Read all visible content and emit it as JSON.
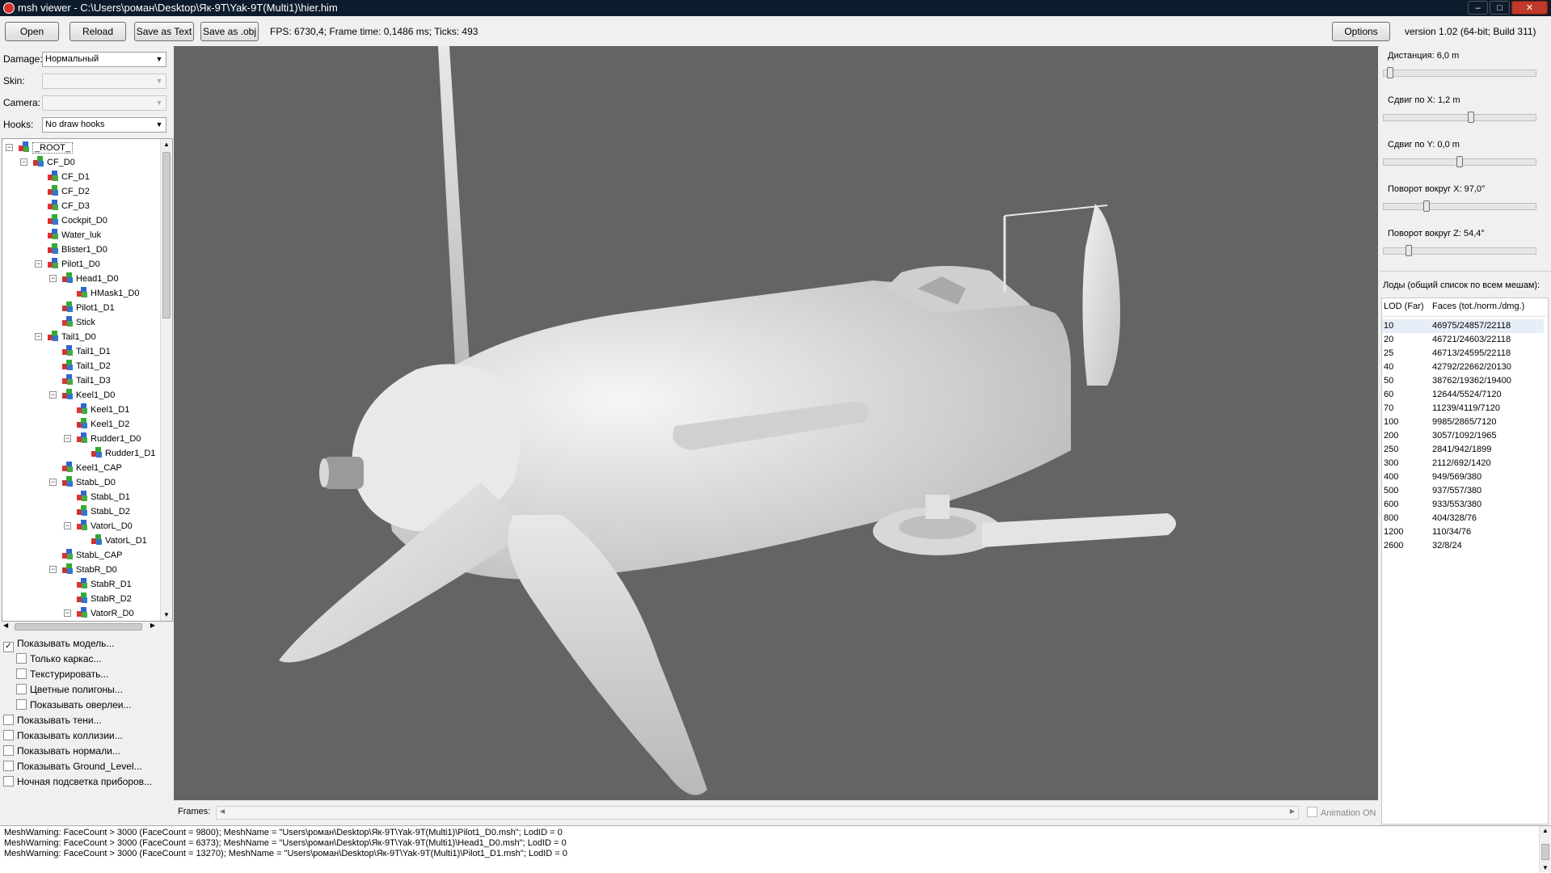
{
  "window": {
    "title": "msh viewer - C:\\Users\\роман\\Desktop\\Як-9Т\\Yak-9T(Multi1)\\hier.him"
  },
  "toolbar": {
    "open": "Open",
    "reload": "Reload",
    "save_text": "Save as Text",
    "save_obj": "Save as .obj",
    "stats": "FPS: 6730,4; Frame time: 0,1486 ms; Ticks: 493",
    "options": "Options",
    "version": "version 1.02 (64-bit; Build 311)"
  },
  "left": {
    "damage_label": "Damage:",
    "damage_value": "Нормальный",
    "skin_label": "Skin:",
    "skin_value": "",
    "camera_label": "Camera:",
    "camera_value": "",
    "hooks_label": "Hooks:",
    "hooks_value": "No draw hooks",
    "tree": [
      {
        "label": "_ROOT_",
        "depth": 0,
        "exp": "-"
      },
      {
        "label": "CF_D0",
        "depth": 1,
        "exp": "-"
      },
      {
        "label": "CF_D1",
        "depth": 2,
        "exp": ""
      },
      {
        "label": "CF_D2",
        "depth": 2,
        "exp": ""
      },
      {
        "label": "CF_D3",
        "depth": 2,
        "exp": ""
      },
      {
        "label": "Cockpit_D0",
        "depth": 2,
        "exp": ""
      },
      {
        "label": "Water_luk",
        "depth": 2,
        "exp": ""
      },
      {
        "label": "Blister1_D0",
        "depth": 2,
        "exp": ""
      },
      {
        "label": "Pilot1_D0",
        "depth": 2,
        "exp": "-"
      },
      {
        "label": "Head1_D0",
        "depth": 3,
        "exp": "-"
      },
      {
        "label": "HMask1_D0",
        "depth": 4,
        "exp": ""
      },
      {
        "label": "Pilot1_D1",
        "depth": 3,
        "exp": ""
      },
      {
        "label": "Stick",
        "depth": 3,
        "exp": ""
      },
      {
        "label": "Tail1_D0",
        "depth": 2,
        "exp": "-"
      },
      {
        "label": "Tail1_D1",
        "depth": 3,
        "exp": ""
      },
      {
        "label": "Tail1_D2",
        "depth": 3,
        "exp": ""
      },
      {
        "label": "Tail1_D3",
        "depth": 3,
        "exp": ""
      },
      {
        "label": "Keel1_D0",
        "depth": 3,
        "exp": "-"
      },
      {
        "label": "Keel1_D1",
        "depth": 4,
        "exp": ""
      },
      {
        "label": "Keel1_D2",
        "depth": 4,
        "exp": ""
      },
      {
        "label": "Rudder1_D0",
        "depth": 4,
        "exp": "-"
      },
      {
        "label": "Rudder1_D1",
        "depth": 5,
        "exp": ""
      },
      {
        "label": "Keel1_CAP",
        "depth": 3,
        "exp": ""
      },
      {
        "label": "StabL_D0",
        "depth": 3,
        "exp": "-"
      },
      {
        "label": "StabL_D1",
        "depth": 4,
        "exp": ""
      },
      {
        "label": "StabL_D2",
        "depth": 4,
        "exp": ""
      },
      {
        "label": "VatorL_D0",
        "depth": 4,
        "exp": "-"
      },
      {
        "label": "VatorL_D1",
        "depth": 5,
        "exp": ""
      },
      {
        "label": "StabL_CAP",
        "depth": 3,
        "exp": ""
      },
      {
        "label": "StabR_D0",
        "depth": 3,
        "exp": "-"
      },
      {
        "label": "StabR_D1",
        "depth": 4,
        "exp": ""
      },
      {
        "label": "StabR_D2",
        "depth": 4,
        "exp": ""
      },
      {
        "label": "VatorR_D0",
        "depth": 4,
        "exp": "-"
      }
    ],
    "checks": [
      {
        "label": "Показывать модель...",
        "checked": true,
        "indent": 0
      },
      {
        "label": "Только каркас...",
        "checked": false,
        "indent": 1
      },
      {
        "label": "Текстурировать...",
        "checked": false,
        "indent": 1
      },
      {
        "label": "Цветные полигоны...",
        "checked": false,
        "indent": 1
      },
      {
        "label": "Показывать оверлеи...",
        "checked": false,
        "indent": 1
      },
      {
        "label": "Показывать тени...",
        "checked": false,
        "indent": 0
      },
      {
        "label": "Показывать коллизии...",
        "checked": false,
        "indent": 0
      },
      {
        "label": "Показывать нормали...",
        "checked": false,
        "indent": 0
      },
      {
        "label": "Показывать Ground_Level...",
        "checked": false,
        "indent": 0
      },
      {
        "label": "Ночная подсветка приборов...",
        "checked": false,
        "indent": 0
      }
    ]
  },
  "frames": {
    "label": "Frames:",
    "animation": "Animation ON"
  },
  "right": {
    "sliders": [
      {
        "label": "Дистанция:  6,0 m",
        "value": 0.02
      },
      {
        "label": "Сдвиг по X:  1,2 m",
        "value": 0.58
      },
      {
        "label": "Сдвиг по Y:  0,0 m",
        "value": 0.5
      },
      {
        "label": "Поворот вокруг X:  97,0°",
        "value": 0.27
      },
      {
        "label": "Поворот вокруг Z:  54,4°",
        "value": 0.15
      }
    ],
    "lod_title": "Лоды (общий список по всем мешам):",
    "lod_header": [
      "LOD (Far)",
      "Faces (tot./norm./dmg.)"
    ],
    "lods": [
      [
        "10",
        "46975/24857/22118"
      ],
      [
        "20",
        "46721/24603/22118"
      ],
      [
        "25",
        "46713/24595/22118"
      ],
      [
        "40",
        "42792/22662/20130"
      ],
      [
        "50",
        "38762/19362/19400"
      ],
      [
        "60",
        "12644/5524/7120"
      ],
      [
        "70",
        "11239/4119/7120"
      ],
      [
        "100",
        "9985/2865/7120"
      ],
      [
        "200",
        "3057/1092/1965"
      ],
      [
        "250",
        "2841/942/1899"
      ],
      [
        "300",
        "2112/692/1420"
      ],
      [
        "400",
        "949/569/380"
      ],
      [
        "500",
        "937/557/380"
      ],
      [
        "600",
        "933/553/380"
      ],
      [
        "800",
        "404/328/76"
      ],
      [
        "1200",
        "110/34/76"
      ],
      [
        "2600",
        "32/8/24"
      ]
    ]
  },
  "log": [
    "MeshWarning: FaceCount > 3000 (FaceCount = 9800); MeshName = \"Users\\роман\\Desktop\\Як-9Т\\Yak-9T(Multi1)\\Pilot1_D0.msh\"; LodID = 0",
    "MeshWarning: FaceCount > 3000 (FaceCount = 6373); MeshName = \"Users\\роман\\Desktop\\Як-9Т\\Yak-9T(Multi1)\\Head1_D0.msh\"; LodID = 0",
    "MeshWarning: FaceCount > 3000 (FaceCount = 13270); MeshName = \"Users\\роман\\Desktop\\Як-9Т\\Yak-9T(Multi1)\\Pilot1_D1.msh\"; LodID = 0"
  ]
}
